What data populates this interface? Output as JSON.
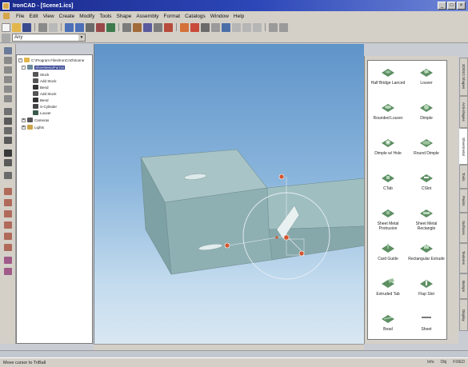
{
  "window": {
    "title": "IronCAD - [Scene1.ics]"
  },
  "menu": [
    "File",
    "Edit",
    "View",
    "Create",
    "Modify",
    "Tools",
    "Shape",
    "Assembly",
    "Format",
    "Catalogs",
    "Window",
    "Help"
  ],
  "toolbar": {
    "combo_value": "Any"
  },
  "tree": {
    "items": [
      {
        "label": "C:\\Program Files\\IronCAD\\Scene",
        "indent": 0,
        "expander": "-"
      },
      {
        "label": "SheetMetalPart16",
        "indent": 1,
        "expander": "-",
        "selected": true
      },
      {
        "label": "Stock",
        "indent": 2
      },
      {
        "label": "Add Stock",
        "indent": 2
      },
      {
        "label": "Bend",
        "indent": 2
      },
      {
        "label": "Add Stock",
        "indent": 2
      },
      {
        "label": "Bend",
        "indent": 2
      },
      {
        "label": "S-Cylinder",
        "indent": 2
      },
      {
        "label": "Louver",
        "indent": 2
      },
      {
        "label": "Cameras",
        "indent": 0,
        "expander": "+"
      },
      {
        "label": "Lights",
        "indent": 0,
        "expander": "+"
      }
    ]
  },
  "catalog": {
    "items": [
      {
        "label": "Half Bridge Lanced"
      },
      {
        "label": "Louver"
      },
      {
        "label": "Rounded Louver"
      },
      {
        "label": "Dimple"
      },
      {
        "label": "Dimple w/ Hole"
      },
      {
        "label": "Round Dimple"
      },
      {
        "label": "CTab"
      },
      {
        "label": "CSlot"
      },
      {
        "label": "Sheet Metal Protrusion"
      },
      {
        "label": "Sheet Metal Rectangle"
      },
      {
        "label": "Card Guide"
      },
      {
        "label": "Rectangular Extrude"
      },
      {
        "label": "Extruded Tab"
      },
      {
        "label": "Flap Slot"
      },
      {
        "label": "Bead"
      },
      {
        "label": "Sheet"
      }
    ]
  },
  "side_tabs": [
    "3D/ISO Shapes",
    "Anti-shapes",
    "Sheetmetal",
    "Tools",
    "Paints",
    "Surfaces",
    "Textures",
    "Bumps",
    "Display"
  ],
  "status": {
    "message": "Move cursor to TriBall",
    "right": [
      "Info",
      "Obj",
      "FIXED"
    ]
  },
  "colors": {
    "viewport_top": "#5f94c9",
    "viewport_bottom": "#d9e7f2",
    "part": "#8fb0b3",
    "handle": "#d3552f"
  }
}
